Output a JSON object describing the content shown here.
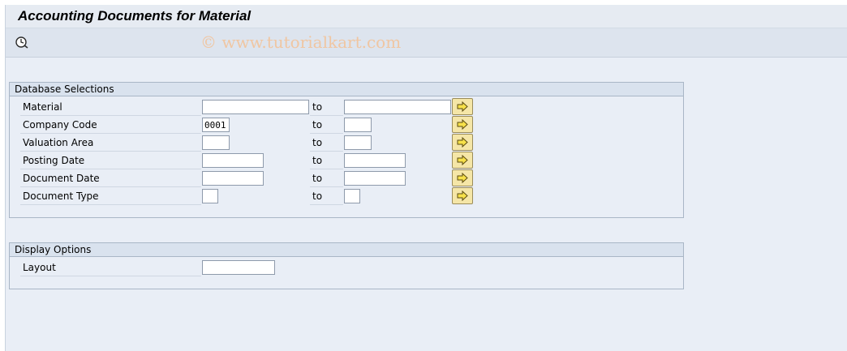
{
  "window": {
    "title": "Accounting Documents for Material",
    "watermark": "© www.tutorialkart.com"
  },
  "toolbar": {
    "execute_icon": "execute-clock-icon"
  },
  "database_selections": {
    "title": "Database Selections",
    "to_label": "to",
    "rows": [
      {
        "label": "Material",
        "from": "",
        "to": ""
      },
      {
        "label": "Company Code",
        "from": "0001",
        "to": ""
      },
      {
        "label": "Valuation Area",
        "from": "",
        "to": ""
      },
      {
        "label": "Posting Date",
        "from": "",
        "to": ""
      },
      {
        "label": "Document Date",
        "from": "",
        "to": ""
      },
      {
        "label": "Document Type",
        "from": "",
        "to": ""
      }
    ],
    "multi_select_icon": "arrow-right-icon"
  },
  "display_options": {
    "title": "Display Options",
    "layout_label": "Layout",
    "layout_value": ""
  },
  "colors": {
    "background": "#e9eef6",
    "group_header": "#d9e2ee",
    "multi_button": "#f5e6a7"
  }
}
